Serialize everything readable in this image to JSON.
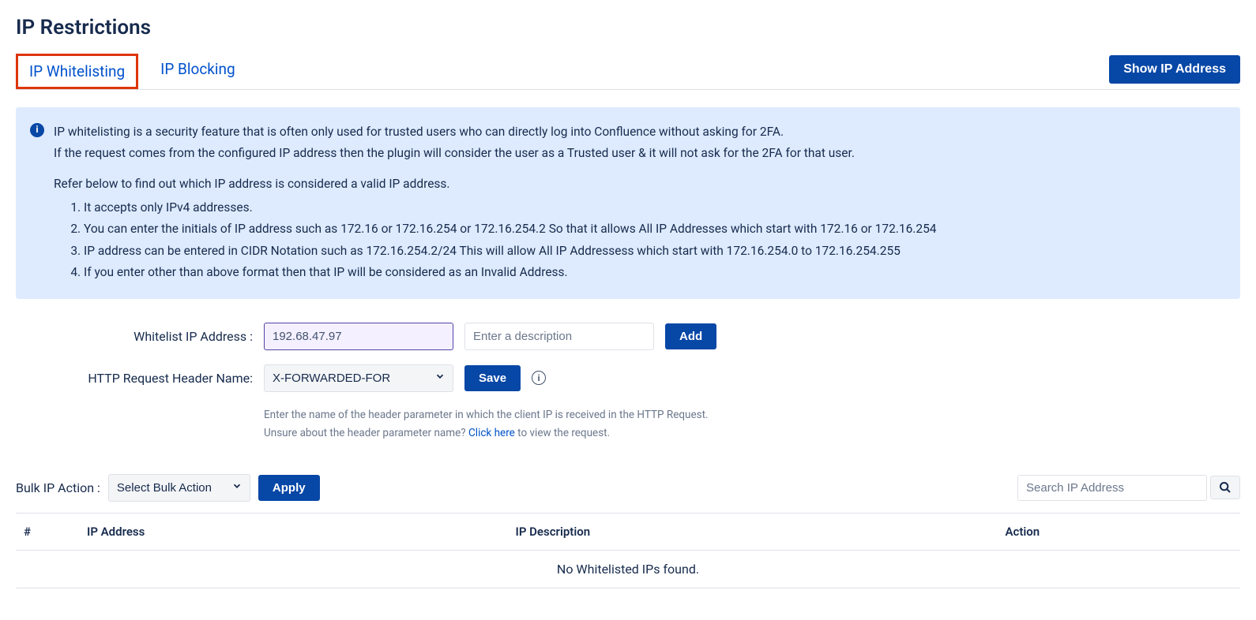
{
  "page_title": "IP Restrictions",
  "tabs": {
    "whitelisting": "IP Whitelisting",
    "blocking": "IP Blocking"
  },
  "show_ip_btn": "Show IP Address",
  "info": {
    "line1": "IP whitelisting is a security feature that is often only used for trusted users who can directly log into Confluence without asking for 2FA.",
    "line2": "If the request comes from the configured IP address then the plugin will consider the user as a Trusted user & it will not ask for the 2FA for that user.",
    "refer": "Refer below to find out which IP address is considered a valid IP address.",
    "rules": [
      "It accepts only IPv4 addresses.",
      "You can enter the initials of IP address such as 172.16 or 172.16.254 or 172.16.254.2 So that it allows All IP Addresses which start with 172.16 or 172.16.254",
      "IP address can be entered in CIDR Notation such as 172.16.254.2/24 This will allow All IP Addressess which start with 172.16.254.0 to 172.16.254.255",
      "If you enter other than above format then that IP will be considered as an Invalid Address."
    ]
  },
  "form": {
    "ip_label": "Whitelist IP Address :",
    "ip_value": "192.68.47.97",
    "desc_placeholder": "Enter a description",
    "add_btn": "Add",
    "header_label": "HTTP Request Header Name:",
    "header_value": "X-FORWARDED-FOR",
    "save_btn": "Save",
    "help_line1": "Enter the name of the header parameter in which the client IP is received in the HTTP Request.",
    "help_line2a": "Unsure about the header parameter name? ",
    "help_link": "Click here",
    "help_line2b": " to view the request."
  },
  "bulk": {
    "label": "Bulk IP Action :",
    "select": "Select Bulk Action",
    "apply": "Apply",
    "search_placeholder": "Search IP Address"
  },
  "table": {
    "col_num": "#",
    "col_ip": "IP Address",
    "col_desc": "IP Description",
    "col_action": "Action",
    "empty": "No Whitelisted IPs found."
  }
}
